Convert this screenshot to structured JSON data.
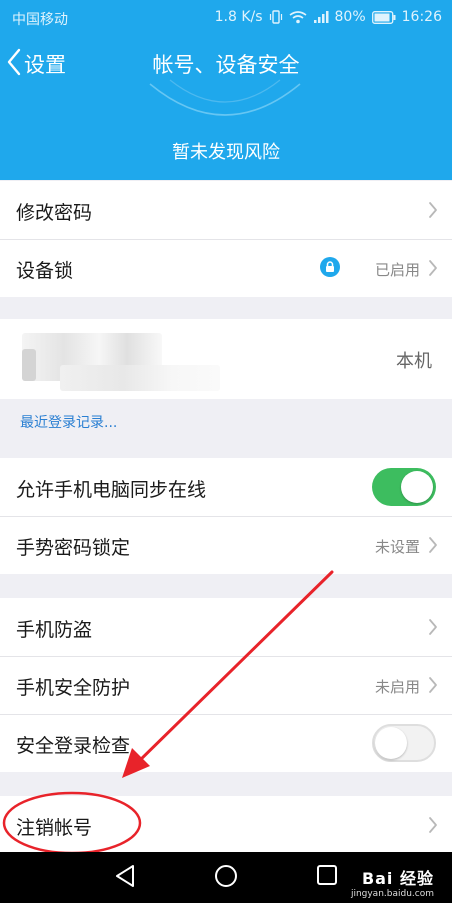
{
  "status_bar": {
    "carrier": "中国移动",
    "speed": "1.8 K/s",
    "battery": "80%",
    "time": "16:26"
  },
  "nav": {
    "back_label": "设置",
    "title": "帐号、设备安全"
  },
  "risk_status": "暂未发现风险",
  "group1": [
    {
      "label": "修改密码",
      "value": ""
    },
    {
      "label": "设备锁",
      "value": "已启用"
    }
  ],
  "device": {
    "value": "本机",
    "recent_link": "最近登录记录..."
  },
  "group2": [
    {
      "label": "允许手机电脑同步在线",
      "toggle": "on"
    },
    {
      "label": "手势密码锁定",
      "value": "未设置"
    }
  ],
  "group3": [
    {
      "label": "手机防盗",
      "value": ""
    },
    {
      "label": "手机安全防护",
      "value": "未启用"
    },
    {
      "label": "安全登录检查",
      "toggle": "off"
    }
  ],
  "group4": [
    {
      "label": "注销帐号",
      "value": ""
    }
  ],
  "watermark": {
    "main": "Bai 经验",
    "sub": "jingyan.baidu.com"
  },
  "colors": {
    "header": "#1fa8ec",
    "toggle_on": "#3dbd5f",
    "annotation": "#e8232a",
    "link": "#2a7fd2"
  }
}
